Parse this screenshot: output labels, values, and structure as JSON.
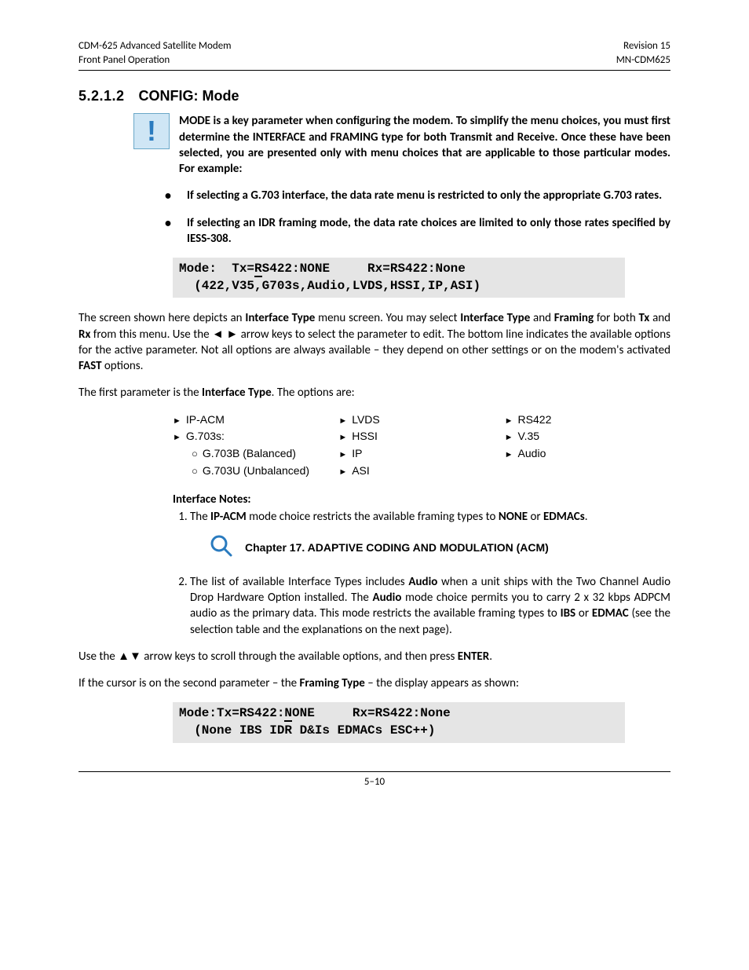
{
  "header": {
    "left_line1": "CDM-625 Advanced Satellite Modem",
    "left_line2": "Front Panel Operation",
    "right_line1": "Revision 15",
    "right_line2": "MN-CDM625"
  },
  "section": {
    "number": "5.2.1.2",
    "title": "CONFIG:  Mode"
  },
  "intro_note": "MODE is a key parameter when configuring the modem. To simplify the menu choices, you must first determine the INTERFACE and FRAMING type for both Transmit and Receive. Once these have been selected, you are presented only with menu choices that are applicable to those particular modes. For example:",
  "intro_bullets": [
    "If selecting a G.703 interface, the data rate menu is restricted to only the appropriate G.703 rates.",
    "If selecting an IDR framing mode, the data rate choices are limited to only those rates specified by IESS-308."
  ],
  "lcd1": {
    "pre1a": "Mode:  Tx=",
    "cursor1": "R",
    "post1a": "S422:NONE     Rx=RS422:None",
    "line2": "  (422,V35,G703s,Audio,LVDS,HSSI,IP,ASI)"
  },
  "para1_parts": {
    "a": "The screen shown here depicts an ",
    "b": "Interface Type",
    "c": " menu screen. You may select ",
    "d": "Interface Type",
    "e": " and ",
    "f": "Framing",
    "g": " for both ",
    "h": "Tx",
    "i": " and ",
    "j": "Rx",
    "k": " from this menu. Use the ◄ ► arrow keys to select the parameter to edit. The bottom line indicates the available options for the active parameter. Not all options are always available – they depend on other settings or on the modem's activated ",
    "l": "FAST",
    "m": " options."
  },
  "para2_parts": {
    "a": "The first parameter is the ",
    "b": "Interface Type",
    "c": ". The options are:"
  },
  "options": {
    "col1": [
      {
        "label": "IP-ACM"
      },
      {
        "label": "G.703s:",
        "sub": [
          "G.703B (Balanced)",
          "G.703U (Unbalanced)"
        ]
      }
    ],
    "col2": [
      {
        "label": "LVDS"
      },
      {
        "label": "HSSI"
      },
      {
        "label": "IP"
      },
      {
        "label": "ASI"
      }
    ],
    "col3": [
      {
        "label": "RS422"
      },
      {
        "label": "V.35"
      },
      {
        "label": "Audio"
      }
    ]
  },
  "interface_notes_heading": "Interface Notes:",
  "note1_parts": {
    "a": "The ",
    "b": "IP-ACM",
    "c": " mode choice restricts the available framing types to ",
    "d": "NONE",
    "e": " or ",
    "f": "EDMACs",
    "g": "."
  },
  "chapter_ref": "Chapter 17. ADAPTIVE CODING AND MODULATION (ACM)",
  "note2_parts": {
    "a": "The list of available Interface Types includes ",
    "b": "Audio",
    "c": " when a unit ships with the Two Channel Audio Drop Hardware Option installed. The ",
    "d": "Audio",
    "e": " mode choice permits you to carry 2 x 32 kbps ADPCM audio as the primary data. This mode restricts the available framing types to ",
    "f": "IBS",
    "g": " or ",
    "h": "EDMAC",
    "i": " (see the selection table and the explanations on the next page)."
  },
  "para3_parts": {
    "a": "Use the ▲▼ arrow keys to scroll through the available options, and then press ",
    "b": "ENTER",
    "c": "."
  },
  "para4_parts": {
    "a": "If the cursor is on the second parameter – the ",
    "b": "Framing Type",
    "c": " – the display appears as shown:"
  },
  "lcd2": {
    "pre1a": "Mode:Tx=RS422:",
    "cursor1": "N",
    "post1a": "ONE     Rx=RS422:None",
    "line2": "  (None IBS IDR D&Is EDMACs ESC++)"
  },
  "footer": "5–10"
}
